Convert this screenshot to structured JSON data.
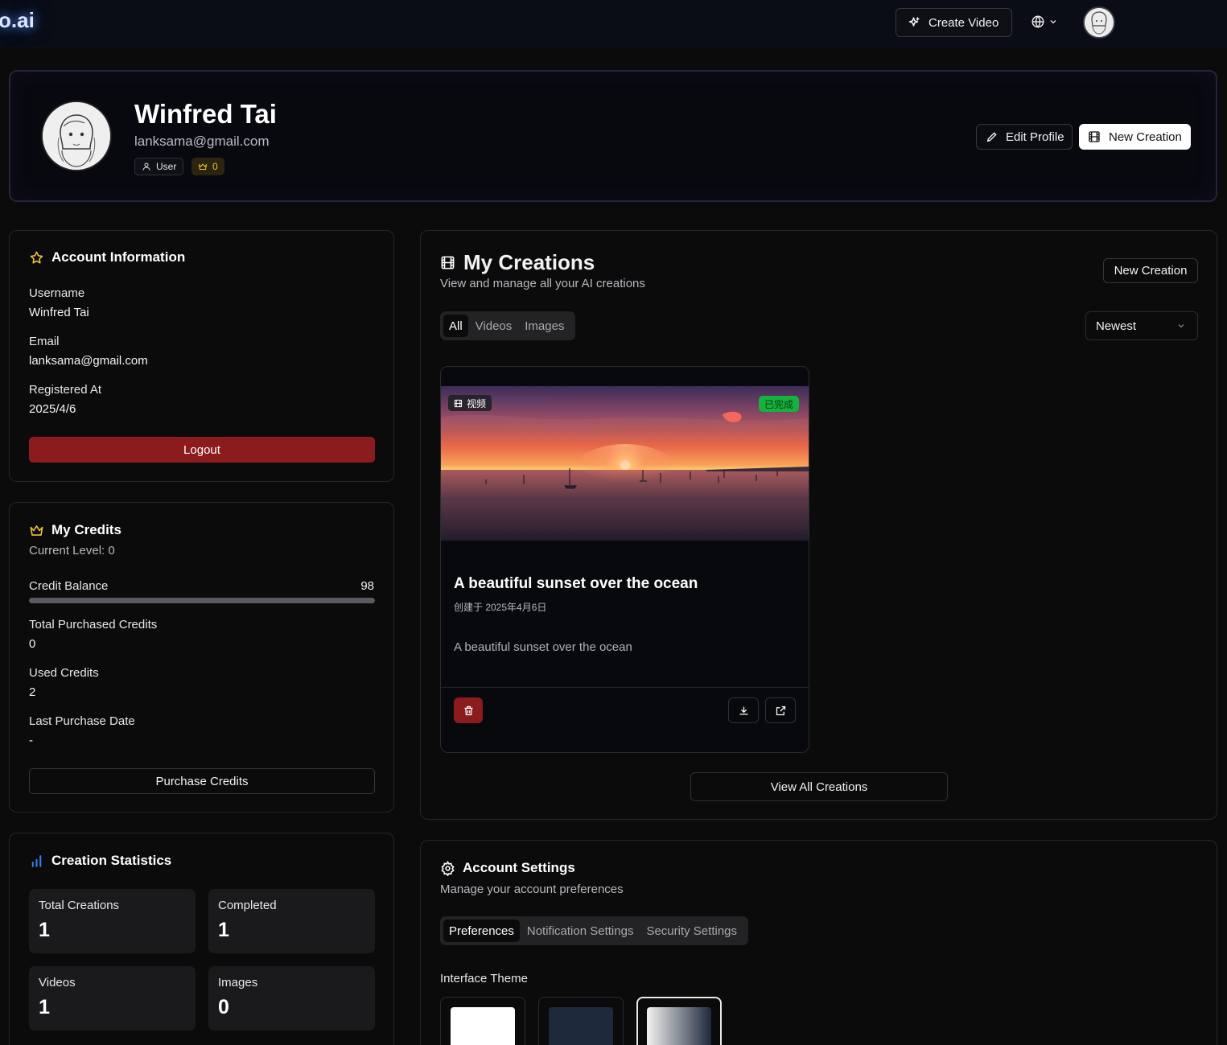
{
  "nav": {
    "logo": "o.ai",
    "create_video": "Create Video"
  },
  "profile": {
    "name": "Winfred Tai",
    "email": "lanksama@gmail.com",
    "role": "User",
    "level": "0",
    "edit_profile": "Edit Profile",
    "new_creation": "New Creation"
  },
  "account": {
    "title": "Account Information",
    "username_label": "Username",
    "username": "Winfred Tai",
    "email_label": "Email",
    "email": "lanksama@gmail.com",
    "registered_label": "Registered At",
    "registered": "2025/4/6",
    "logout": "Logout"
  },
  "credits": {
    "title": "My Credits",
    "current_level": "Current Level: 0",
    "balance_label": "Credit Balance",
    "balance": "98",
    "balance_fill_percent": 100,
    "total_purchased_label": "Total Purchased Credits",
    "total_purchased": "0",
    "used_label": "Used Credits",
    "used": "2",
    "last_purchase_label": "Last Purchase Date",
    "last_purchase": "-",
    "purchase_button": "Purchase Credits"
  },
  "stats": {
    "title": "Creation Statistics",
    "items": [
      {
        "label": "Total Creations",
        "value": "1"
      },
      {
        "label": "Completed",
        "value": "1"
      },
      {
        "label": "Videos",
        "value": "1"
      },
      {
        "label": "Images",
        "value": "0"
      }
    ]
  },
  "creations": {
    "title": "My Creations",
    "subtitle": "View and manage all your AI creations",
    "new_creation": "New Creation",
    "tabs": [
      "All",
      "Videos",
      "Images"
    ],
    "active_tab": "All",
    "sort": "Newest",
    "items": [
      {
        "type_badge": "视频",
        "status": "已完成",
        "title": "A beautiful sunset over the ocean",
        "date": "创建于 2025年4月6日",
        "description": "A beautiful sunset over the ocean"
      }
    ],
    "view_all": "View All Creations"
  },
  "settings": {
    "title": "Account Settings",
    "subtitle": "Manage your account preferences",
    "tabs": [
      "Preferences",
      "Notification Settings",
      "Security Settings"
    ],
    "active_tab": "Preferences",
    "theme_label": "Interface Theme",
    "themes": [
      "light-theme",
      "dark-theme",
      "system-theme"
    ]
  },
  "colors": {
    "danger": "#8b1b1d",
    "success": "#17b13e",
    "gold": "#f0c23a",
    "accent_blue": "#3b82f6"
  }
}
